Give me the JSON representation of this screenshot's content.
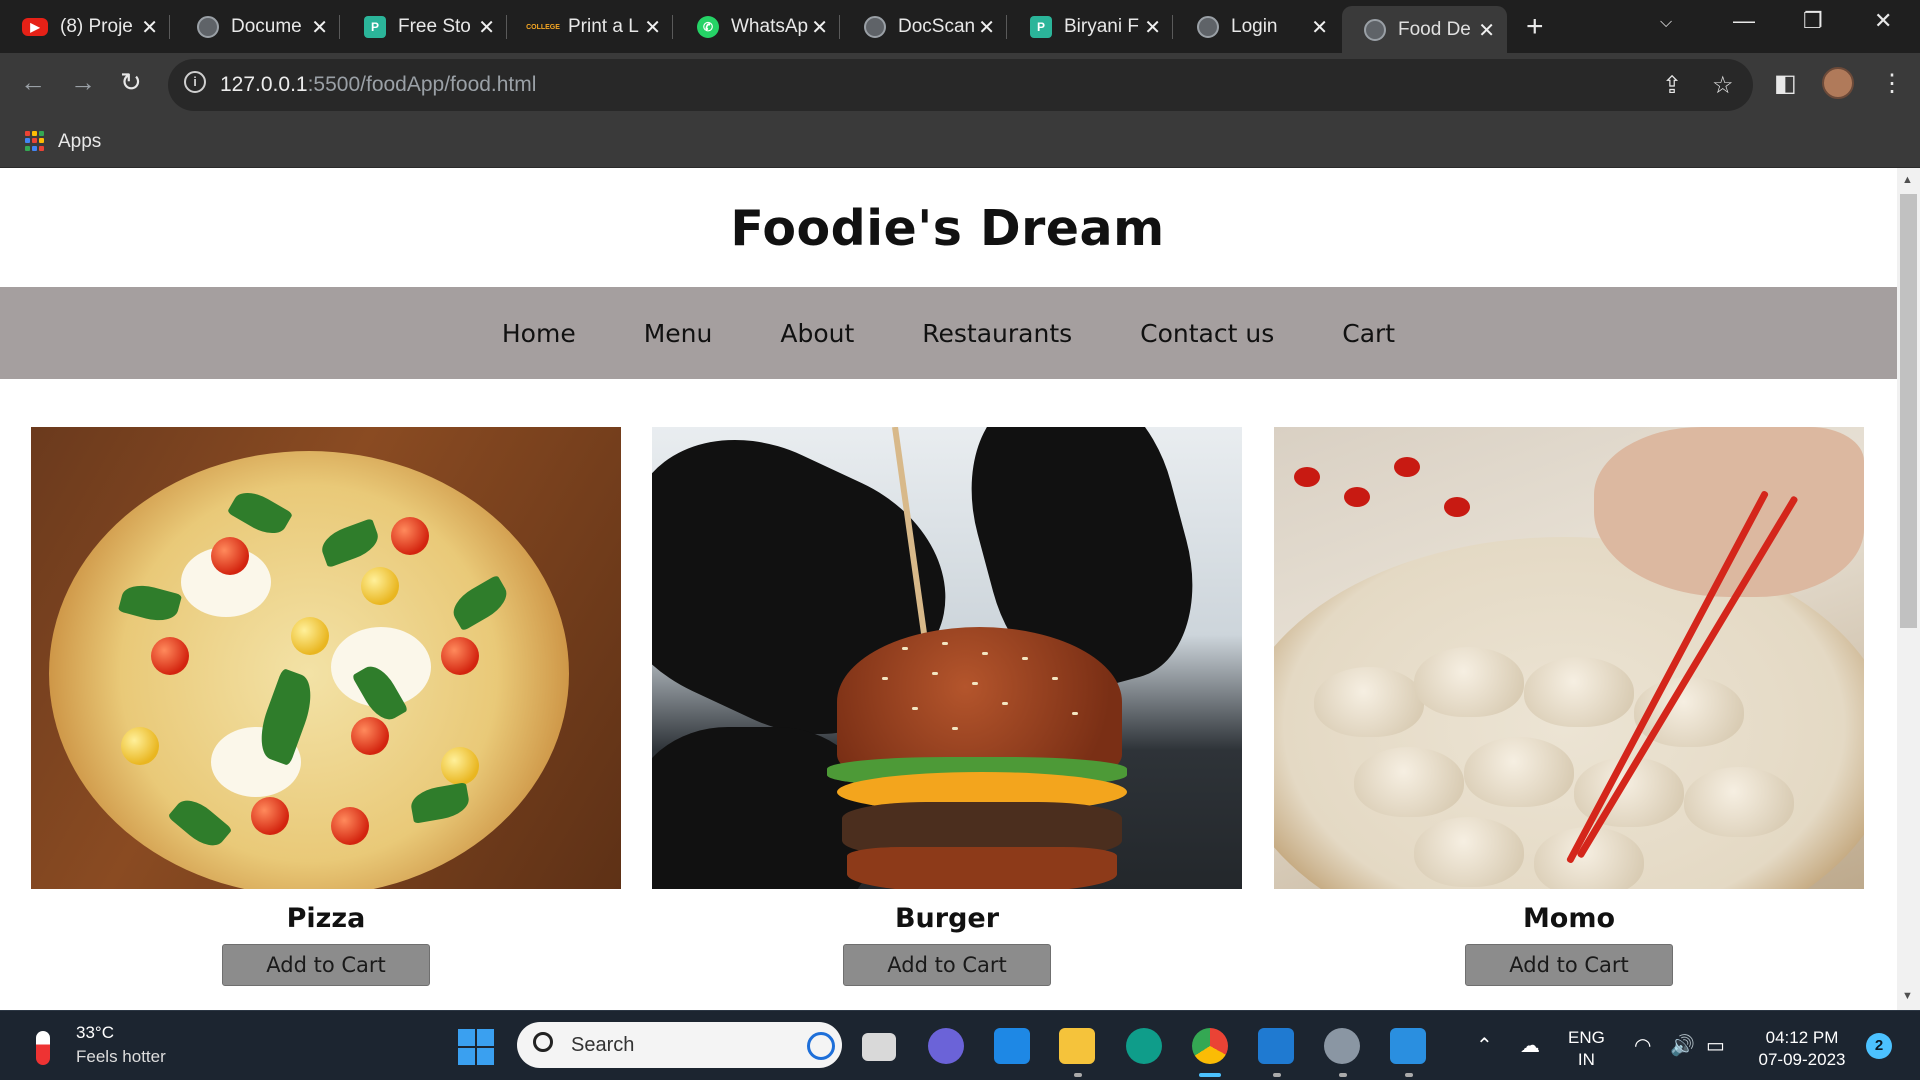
{
  "browser": {
    "tabs": [
      {
        "title": "(8) Proje",
        "icon": "youtube-icon"
      },
      {
        "title": "Docume",
        "icon": "globe-icon"
      },
      {
        "title": "Free Sto",
        "icon": "app-icon"
      },
      {
        "title": "Print a L",
        "icon": "college-icon"
      },
      {
        "title": "WhatsAp",
        "icon": "whatsapp-icon"
      },
      {
        "title": "DocScan",
        "icon": "globe-icon"
      },
      {
        "title": "Biryani F",
        "icon": "app-icon"
      },
      {
        "title": "Login",
        "icon": "globe-icon"
      },
      {
        "title": "Food De",
        "icon": "globe-icon",
        "active": true
      }
    ],
    "url_host": "127.0.0.1",
    "url_path": ":5500/foodApp/food.html",
    "bookmarks": {
      "apps_label": "Apps"
    }
  },
  "page": {
    "title": "Foodie's Dream",
    "nav": [
      "Home",
      "Menu",
      "About",
      "Restaurants",
      "Contact us",
      "Cart"
    ],
    "items": [
      {
        "name": "Pizza",
        "button": "Add to Cart"
      },
      {
        "name": "Burger",
        "button": "Add to Cart"
      },
      {
        "name": "Momo",
        "button": "Add to Cart"
      }
    ]
  },
  "taskbar": {
    "weather": {
      "temp": "33°C",
      "desc": "Feels hotter"
    },
    "search_label": "Search",
    "lang": {
      "line1": "ENG",
      "line2": "IN"
    },
    "clock": {
      "time": "04:12 PM",
      "date": "07-09-2023"
    },
    "notifications": "2"
  },
  "colors": {
    "nav_bg": "#a59f9f",
    "button_bg": "#8c8c8c",
    "browser_dark": "#1f1f1f",
    "taskbar": "#1c2530"
  }
}
